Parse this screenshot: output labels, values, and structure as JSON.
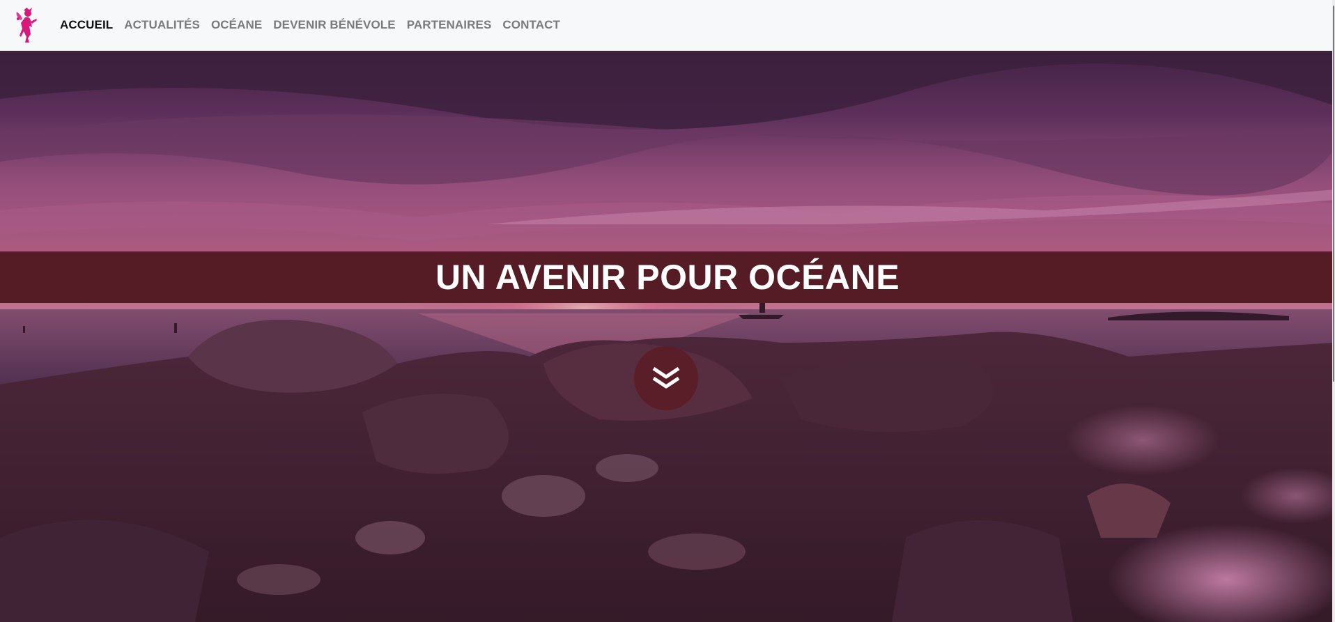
{
  "nav": {
    "logo_icon": "fairy-logo-icon",
    "items": [
      {
        "label": "ACCUEIL",
        "active": true
      },
      {
        "label": "ACTUALITÉS",
        "active": false
      },
      {
        "label": "OCÉANE",
        "active": false
      },
      {
        "label": "DEVENIR BÉNÉVOLE",
        "active": false
      },
      {
        "label": "PARTENAIRES",
        "active": false
      },
      {
        "label": "CONTACT",
        "active": false
      }
    ]
  },
  "hero": {
    "title": "UN AVENIR POUR OCÉANE",
    "scroll_icon": "double-chevron-down-icon",
    "background": "sunset-coastline-photo"
  },
  "colors": {
    "brand_pink": "#d6197a",
    "banner": "#561c26",
    "nav_bg": "#f7f8fa"
  }
}
